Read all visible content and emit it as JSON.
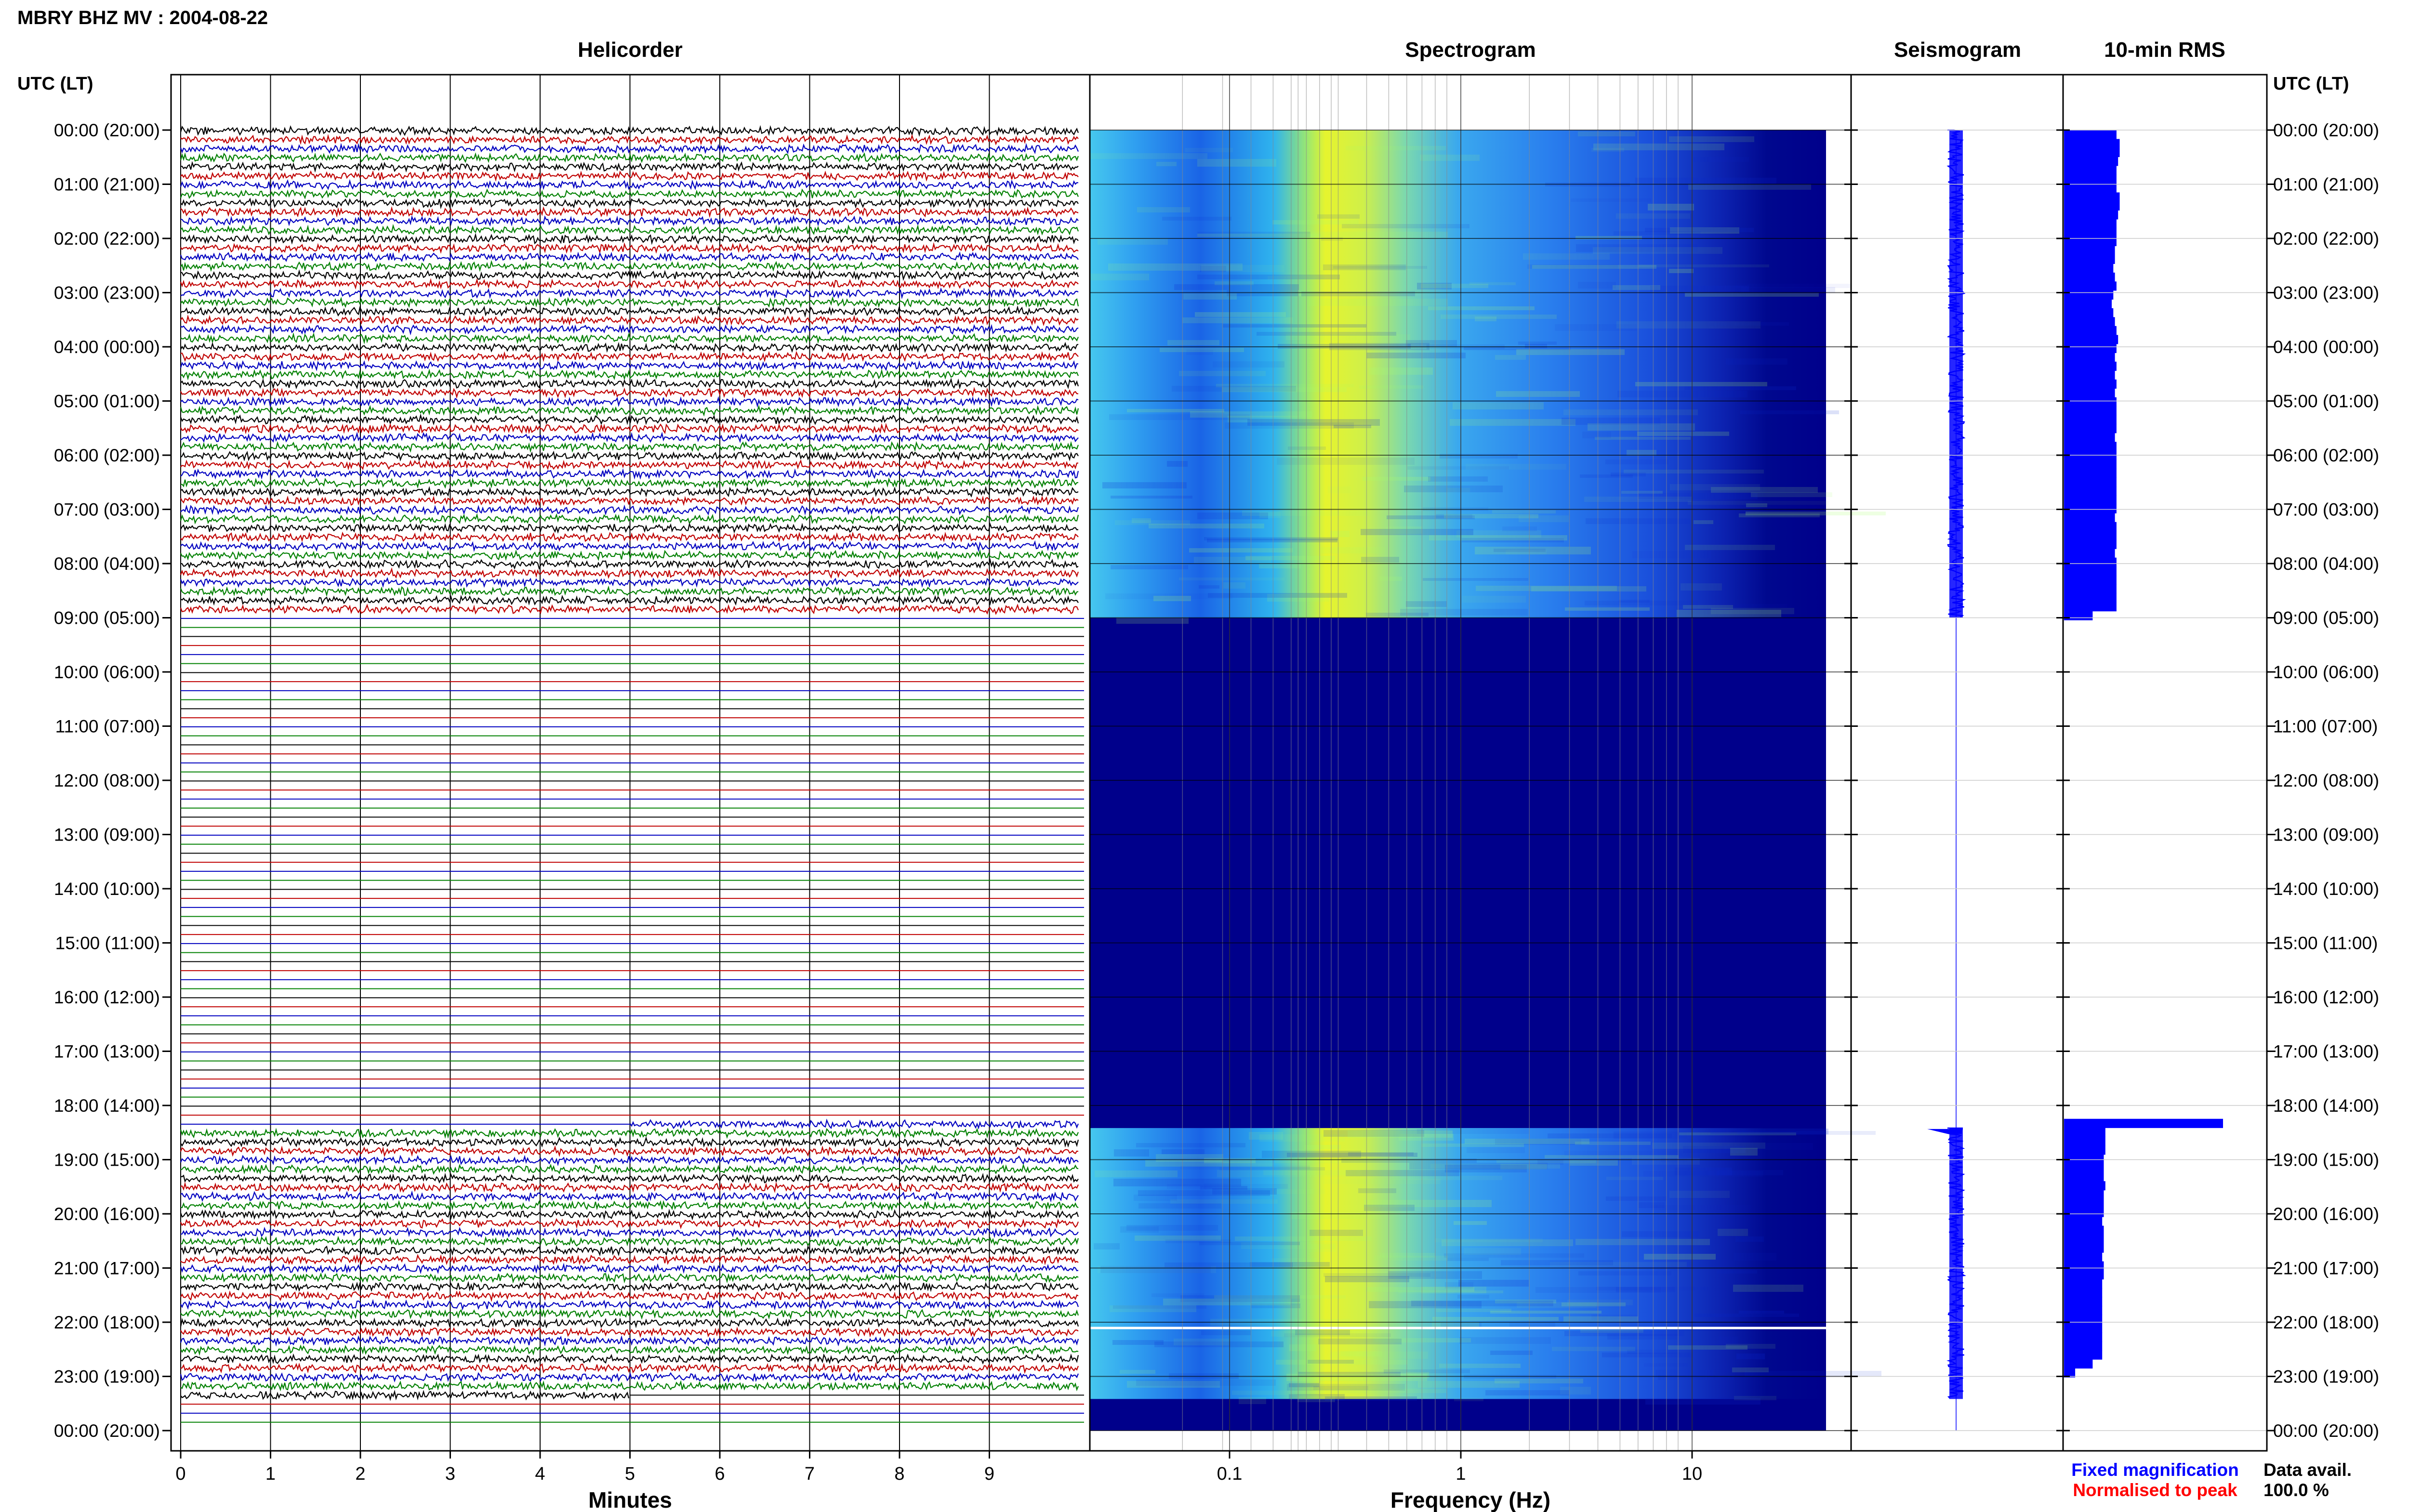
{
  "header": {
    "title": "MBRY BHZ MV : 2004-08-22"
  },
  "panels": {
    "helicorder": "Helicorder",
    "spectrogram": "Spectrogram",
    "seismogram": "Seismogram",
    "rms": "10-min RMS"
  },
  "axes": {
    "time_label_left": "UTC (LT)",
    "time_label_right": "UTC (LT)",
    "time_ticks": [
      "00:00 (20:00)",
      "01:00 (21:00)",
      "02:00 (22:00)",
      "03:00 (23:00)",
      "04:00 (00:00)",
      "05:00 (01:00)",
      "06:00 (02:00)",
      "07:00 (03:00)",
      "08:00 (04:00)",
      "09:00 (05:00)",
      "10:00 (06:00)",
      "11:00 (07:00)",
      "12:00 (08:00)",
      "13:00 (09:00)",
      "14:00 (10:00)",
      "15:00 (11:00)",
      "16:00 (12:00)",
      "17:00 (13:00)",
      "18:00 (14:00)",
      "19:00 (15:00)",
      "20:00 (16:00)",
      "21:00 (17:00)",
      "22:00 (18:00)",
      "23:00 (19:00)",
      "00:00 (20:00)"
    ],
    "minutes_label": "Minutes",
    "minutes_ticks": [
      "0",
      "1",
      "2",
      "3",
      "4",
      "5",
      "6",
      "7",
      "8",
      "9"
    ],
    "frequency_label": "Frequency (Hz)",
    "frequency_ticks": [
      "0.1",
      "1",
      "10"
    ]
  },
  "legend": {
    "fixed": "Fixed magnification",
    "normalised": "Normalised to peak",
    "fixed_color": "#0000ff",
    "normalised_color": "#ff0000"
  },
  "availability": {
    "label": "Data avail.",
    "value": "100.0 %"
  },
  "chart_data": {
    "type": "heatmap",
    "station": "MBRY",
    "channel": "BHZ",
    "network": "MV",
    "date": "2004-08-22",
    "data_segments_utc": [
      [
        "00:00",
        "09:00"
      ],
      [
        "18:25",
        "23:25"
      ]
    ],
    "helicorder_trace_colors": [
      "#000000",
      "#c00000",
      "#0000c0",
      "#008000"
    ],
    "helicorder_minutes_per_line": 10,
    "frequency_axis_scale": "log",
    "spectrogram_colormap": [
      "#00008b",
      "#0050ff",
      "#20c0ff",
      "#a0ff60",
      "#ffff00"
    ],
    "rms_10min_relative": [
      0.33,
      0.35,
      0.35,
      0.34,
      0.33,
      0.33,
      0.33,
      0.35,
      0.35,
      0.34,
      0.33,
      0.33,
      0.33,
      0.32,
      0.32,
      0.31,
      0.32,
      0.33,
      0.31,
      0.3,
      0.31,
      0.32,
      0.33,
      0.34,
      0.33,
      0.32,
      0.33,
      0.32,
      0.33,
      0.32,
      0.33,
      0.33,
      0.33,
      0.33,
      0.32,
      0.33,
      0.33,
      0.33,
      0.33,
      0.33,
      0.33,
      0.33,
      0.33,
      0.32,
      0.33,
      0.33,
      0.33,
      0.32,
      0.33,
      0.33,
      0.33,
      0.33,
      0.33,
      0.33,
      0.18,
      0,
      0,
      0,
      0,
      0,
      0,
      0,
      0,
      0,
      0,
      0,
      0,
      0,
      0,
      0,
      0,
      0,
      0,
      0,
      0,
      0,
      0,
      0,
      0,
      0,
      0,
      0,
      0,
      0,
      0,
      0,
      0,
      0,
      0,
      0,
      0,
      0,
      0,
      0,
      0,
      0,
      0,
      0,
      0,
      0,
      0,
      0,
      0,
      0,
      0,
      0,
      0,
      0,
      0,
      0,
      0,
      1.0,
      0.26,
      0.26,
      0.26,
      0.25,
      0.25,
      0.25,
      0.26,
      0.25,
      0.25,
      0.25,
      0.24,
      0.25,
      0.25,
      0.25,
      0.24,
      0.25,
      0.25,
      0.24,
      0.24,
      0.24,
      0.24,
      0.24,
      0.24,
      0.24,
      0.24,
      0.24,
      0.18,
      0.07,
      0,
      0,
      0,
      0,
      0,
      0
    ],
    "fixed_magnification_color": "#0000ff",
    "normalised_to_peak_color": "#ff0000",
    "data_availability_percent": 100.0
  }
}
